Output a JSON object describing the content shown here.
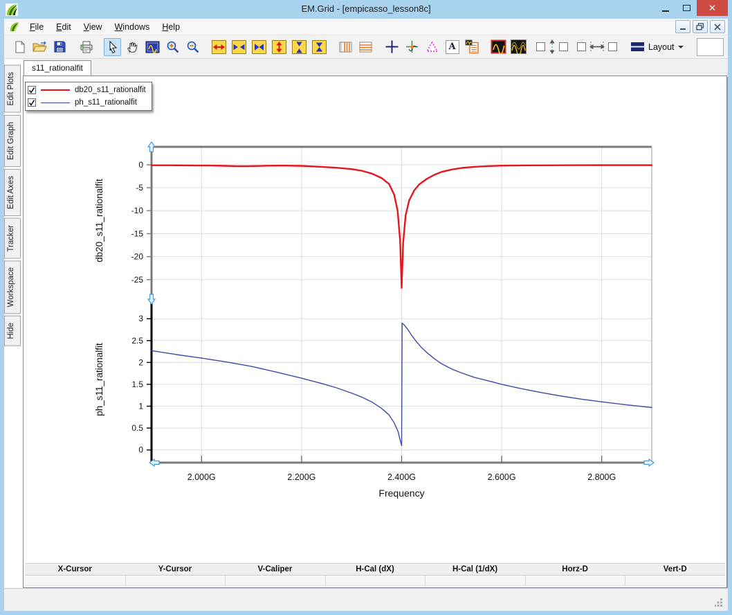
{
  "window": {
    "title": "EM.Grid - [empicasso_lesson8c]"
  },
  "menubar": {
    "items": [
      "File",
      "Edit",
      "View",
      "Windows",
      "Help"
    ]
  },
  "toolbar": {
    "layout_label": "Layout",
    "text_icon_glyph": "A",
    "icons": [
      "new-file",
      "open-file",
      "save",
      "print",
      "select-pointer",
      "pan-hand",
      "fit-curve",
      "zoom-in",
      "zoom-out",
      "expand-x",
      "compress-x",
      "page-x",
      "expand-y",
      "compress-y",
      "page-y",
      "vertical-grid",
      "horizontal-grid",
      "crosshair",
      "tracker",
      "caliper",
      "text-annotation",
      "data-sheet",
      "single-curve-view",
      "multi-curve-view",
      "left-scale-checkbox",
      "vertical-fit",
      "right-scale-checkbox",
      "bottom-left-checkbox",
      "horizontal-fit",
      "bottom-right-checkbox",
      "layout-menu"
    ]
  },
  "sidebar": {
    "tabs": [
      "Edit Plots",
      "Edit Graph",
      "Edit Axes",
      "Tracker",
      "Workspace",
      "Hide"
    ]
  },
  "doc_tab": "s11_rationalfit",
  "legend": {
    "items": [
      {
        "checked": true,
        "label": "db20_s11_rationalfit"
      },
      {
        "checked": true,
        "label": "ph_s11_rationalfit"
      }
    ]
  },
  "xaxis": {
    "label": "Frequency",
    "xlim": [
      1.9,
      2.9
    ],
    "tick_values": [
      2.0,
      2.2,
      2.4,
      2.6,
      2.8
    ],
    "tick_labels": [
      "2.000G",
      "2.200G",
      "2.400G",
      "2.600G",
      "2.800G"
    ]
  },
  "chart_data": [
    {
      "type": "line",
      "ylabel": "db20_s11_rationalfit",
      "yticks": [
        0,
        -5,
        -10,
        -15,
        -20,
        -25
      ],
      "ylim": [
        -28.2,
        3.9
      ],
      "grid": true,
      "series": [
        {
          "name": "db20_s11_rationalfit",
          "color": "#e8141c",
          "x": [
            1.9,
            1.94,
            1.98,
            2.02,
            2.05,
            2.07,
            2.09,
            2.11,
            2.13,
            2.16,
            2.2,
            2.24,
            2.27,
            2.3,
            2.32,
            2.34,
            2.36,
            2.375,
            2.385,
            2.392,
            2.397,
            2.4,
            2.403,
            2.408,
            2.415,
            2.425,
            2.435,
            2.45,
            2.465,
            2.48,
            2.5,
            2.52,
            2.545,
            2.57,
            2.6,
            2.65,
            2.7,
            2.75,
            2.8,
            2.85,
            2.9
          ],
          "y": [
            -0.12,
            -0.13,
            -0.15,
            -0.18,
            -0.25,
            -0.3,
            -0.3,
            -0.27,
            -0.22,
            -0.18,
            -0.25,
            -0.45,
            -0.65,
            -0.95,
            -1.3,
            -1.9,
            -2.9,
            -4.2,
            -6.5,
            -10.0,
            -16.5,
            -26.8,
            -17.0,
            -11.0,
            -7.8,
            -5.6,
            -4.3,
            -3.1,
            -2.2,
            -1.55,
            -1.05,
            -0.7,
            -0.45,
            -0.3,
            -0.2,
            -0.14,
            -0.12,
            -0.11,
            -0.1,
            -0.1,
            -0.1
          ]
        }
      ]
    },
    {
      "type": "line",
      "ylabel": "ph_s11_rationalfit",
      "yticks": [
        3,
        2.5,
        2,
        1.5,
        1,
        0.5,
        0
      ],
      "ylim": [
        -0.29,
        3.51
      ],
      "grid": true,
      "series": [
        {
          "name": "ph_s11_rationalfit",
          "color": "#3b4aa2",
          "x": [
            1.9,
            1.95,
            2.0,
            2.05,
            2.1,
            2.15,
            2.2,
            2.24,
            2.27,
            2.3,
            2.32,
            2.34,
            2.36,
            2.375,
            2.385,
            2.393,
            2.398,
            2.4,
            2.401,
            2.405,
            2.412,
            2.42,
            2.43,
            2.44,
            2.452,
            2.465,
            2.48,
            2.5,
            2.52,
            2.545,
            2.57,
            2.6,
            2.64,
            2.68,
            2.72,
            2.76,
            2.8,
            2.85,
            2.9
          ],
          "y": [
            2.27,
            2.18,
            2.1,
            2.01,
            1.91,
            1.78,
            1.64,
            1.52,
            1.42,
            1.3,
            1.21,
            1.1,
            0.95,
            0.8,
            0.62,
            0.42,
            0.18,
            0.1,
            2.9,
            2.86,
            2.76,
            2.62,
            2.47,
            2.34,
            2.21,
            2.09,
            1.97,
            1.85,
            1.76,
            1.66,
            1.59,
            1.5,
            1.4,
            1.31,
            1.23,
            1.16,
            1.1,
            1.03,
            0.97
          ]
        }
      ]
    }
  ],
  "cursor_table": {
    "columns": [
      "X-Cursor",
      "Y-Cursor",
      "V-Caliper",
      "H-Cal (dX)",
      "H-Cal (1/dX)",
      "Horz-D",
      "Vert-D"
    ],
    "values": [
      "",
      "",
      "",
      "",
      "",
      "",
      ""
    ]
  }
}
